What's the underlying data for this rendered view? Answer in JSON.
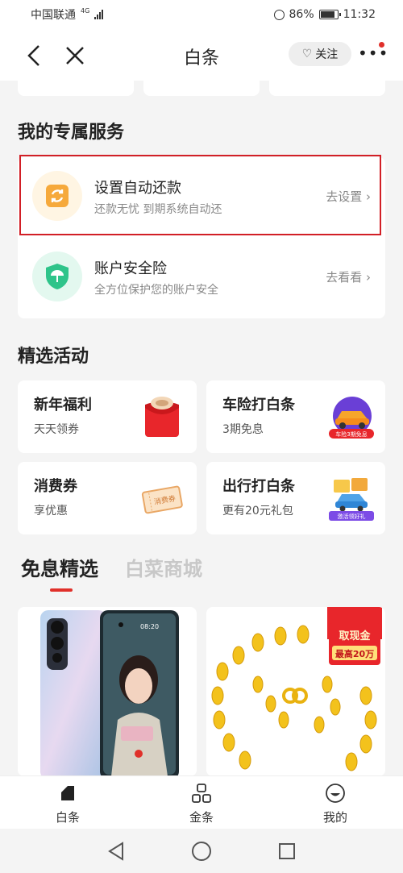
{
  "status_bar": {
    "carrier": "中国联通",
    "network": "4G",
    "battery": "86%",
    "battery_level": 0.86,
    "time": "11:32"
  },
  "nav": {
    "title": "白条",
    "follow_label": "关注",
    "back_icon": "back-chevron-icon",
    "close_icon": "close-icon",
    "more_icon": "more-dots-icon"
  },
  "services": {
    "title": "我的专属服务",
    "items": [
      {
        "title": "设置自动还款",
        "subtitle": "还款无忧 到期系统自动还",
        "action": "去设置",
        "icon": "auto-repay-icon",
        "color": "#f6a93b"
      },
      {
        "title": "账户安全险",
        "subtitle": "全方位保护您的账户安全",
        "action": "去看看",
        "icon": "shield-umbrella-icon",
        "color": "#2ec48a"
      }
    ]
  },
  "activities": {
    "title": "精选活动",
    "items": [
      {
        "title": "新年福利",
        "subtitle": "天天领券",
        "icon": "red-envelope-icon"
      },
      {
        "title": "车险打白条",
        "subtitle": "3期免息",
        "icon": "car-insurance-icon",
        "badge": "车险3期免息"
      },
      {
        "title": "消费券",
        "subtitle": "享优惠",
        "icon": "coupon-icon",
        "badge": "消费券"
      },
      {
        "title": "出行打白条",
        "subtitle": "更有20元礼包",
        "icon": "travel-car-icon",
        "badge": "激活领好礼"
      }
    ]
  },
  "product_tabs": {
    "active": "免息精选",
    "inactive": "白菜商城"
  },
  "products": {
    "phone_screen_time": "08:20",
    "promo_badge_line1": "取现金",
    "promo_badge_line2": "最高20万"
  },
  "bottom_tabs": [
    {
      "label": "白条",
      "icon": "baitiao-icon"
    },
    {
      "label": "金条",
      "icon": "grid-icon"
    },
    {
      "label": "我的",
      "icon": "smiley-icon"
    }
  ],
  "colors": {
    "accent_red": "#e0302a",
    "highlight_border": "#d21f26",
    "background": "#f4f4f4"
  }
}
